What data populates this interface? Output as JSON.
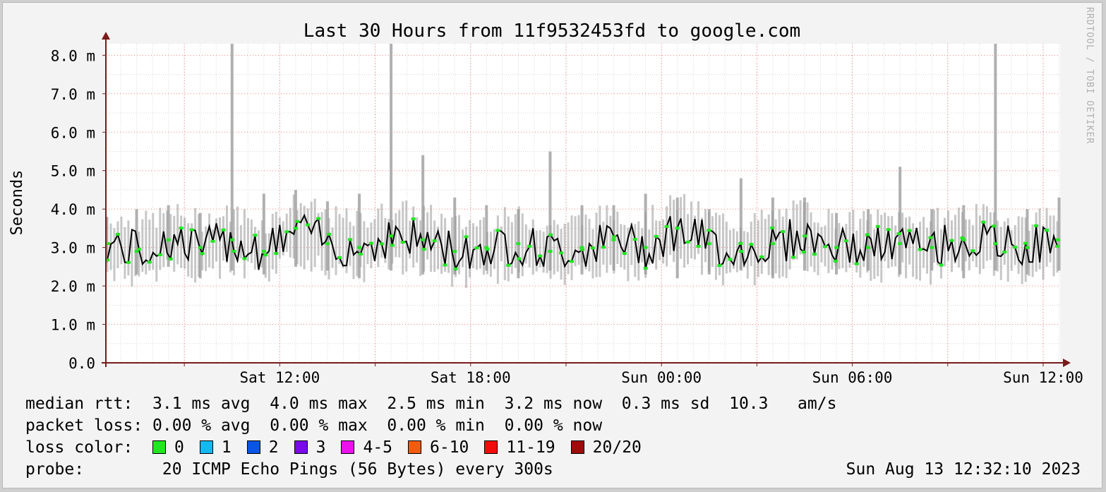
{
  "chart_data": {
    "type": "line",
    "title": "Last 30 Hours from 11f9532453fd to google.com",
    "ylabel": "Seconds",
    "xlabel": "",
    "ylim": [
      0,
      0.0083
    ],
    "y_unit": "s",
    "y_ticks": [
      {
        "value": 0.0,
        "label": "0.0"
      },
      {
        "value": 0.001,
        "label": "1.0 m"
      },
      {
        "value": 0.002,
        "label": "2.0 m"
      },
      {
        "value": 0.003,
        "label": "3.0 m"
      },
      {
        "value": 0.004,
        "label": "4.0 m"
      },
      {
        "value": 0.005,
        "label": "5.0 m"
      },
      {
        "value": 0.006,
        "label": "6.0 m"
      },
      {
        "value": 0.007,
        "label": "7.0 m"
      },
      {
        "value": 0.008,
        "label": "8.0 m"
      }
    ],
    "x_range": [
      "2023-08-12 06:32",
      "2023-08-13 12:32"
    ],
    "x_ticks": [
      {
        "value": "2023-08-12 12:00",
        "label": "Sat 12:00"
      },
      {
        "value": "2023-08-12 18:00",
        "label": "Sat 18:00"
      },
      {
        "value": "2023-08-13 00:00",
        "label": "Sun 00:00"
      },
      {
        "value": "2023-08-13 06:00",
        "label": "Sun 06:00"
      },
      {
        "value": "2023-08-13 12:00",
        "label": "Sun 12:00"
      }
    ],
    "grid": true,
    "series": [
      {
        "name": "median rtt",
        "color": "#000000",
        "marker_color": "#22e622",
        "x": [
          "2023-08-12 06:30",
          "2023-08-12 07:30",
          "2023-08-12 08:30",
          "2023-08-12 09:30",
          "2023-08-12 10:30",
          "2023-08-12 11:30",
          "2023-08-12 12:30",
          "2023-08-12 13:30",
          "2023-08-12 14:30",
          "2023-08-12 15:30",
          "2023-08-12 16:30",
          "2023-08-12 17:30",
          "2023-08-12 18:30",
          "2023-08-12 19:30",
          "2023-08-12 20:30",
          "2023-08-12 21:30",
          "2023-08-12 22:30",
          "2023-08-12 23:30",
          "2023-08-13 00:30",
          "2023-08-13 01:30",
          "2023-08-13 02:30",
          "2023-08-13 03:30",
          "2023-08-13 04:30",
          "2023-08-13 05:30",
          "2023-08-13 06:30",
          "2023-08-13 07:30",
          "2023-08-13 08:30",
          "2023-08-13 09:30",
          "2023-08-13 10:30",
          "2023-08-13 11:30",
          "2023-08-13 12:30"
        ],
        "values": [
          0.0031,
          0.0029,
          0.0032,
          0.003,
          0.0032,
          0.0029,
          0.0035,
          0.0031,
          0.003,
          0.0033,
          0.0032,
          0.0029,
          0.003,
          0.0031,
          0.0029,
          0.003,
          0.0032,
          0.003,
          0.0035,
          0.0031,
          0.0029,
          0.0031,
          0.0033,
          0.003,
          0.003,
          0.0031,
          0.003,
          0.0032,
          0.0031,
          0.003,
          0.0032
        ]
      },
      {
        "name": "max",
        "color": "#b0b0b0",
        "values": [
          0.0038,
          0.004,
          0.0041,
          0.0039,
          0.0083,
          0.0044,
          0.0045,
          0.0042,
          0.0044,
          0.0083,
          0.0054,
          0.0043,
          0.0041,
          0.004,
          0.0055,
          0.0041,
          0.0041,
          0.0044,
          0.0043,
          0.004,
          0.0048,
          0.0043,
          0.0043,
          0.0039,
          0.004,
          0.0051,
          0.004,
          0.0041,
          0.0083,
          0.004,
          0.0043
        ]
      },
      {
        "name": "min",
        "color": "#b0b0b0",
        "values": [
          0.0026,
          0.0023,
          0.0025,
          0.0022,
          0.0024,
          0.0023,
          0.0025,
          0.0024,
          0.0022,
          0.0024,
          0.0023,
          0.0023,
          0.0024,
          0.0022,
          0.0024,
          0.0023,
          0.0024,
          0.0023,
          0.0022,
          0.0023,
          0.0024,
          0.0022,
          0.0024,
          0.0023,
          0.0024,
          0.0023,
          0.0024,
          0.0022,
          0.0024,
          0.0023,
          0.0024
        ]
      }
    ]
  },
  "legend": {
    "median_rtt": {
      "label": "median rtt:",
      "avg": "3.1 ms avg",
      "max": "4.0 ms max",
      "min": "2.5 ms min",
      "now": "3.2 ms now",
      "sd": "0.3 ms sd",
      "ams_value": "10.3",
      "ams_unit": "am/s"
    },
    "packet_loss": {
      "label": "packet loss:",
      "avg": "0.00 % avg",
      "max": "0.00 % max",
      "min": "0.00 % min",
      "now": "0.00 % now"
    },
    "loss_color": {
      "label": "loss color:",
      "items": [
        {
          "label": "0",
          "color": "#22e622"
        },
        {
          "label": "1",
          "color": "#13b9f0"
        },
        {
          "label": "2",
          "color": "#0b55e6"
        },
        {
          "label": "3",
          "color": "#7a0ae8"
        },
        {
          "label": "4-5",
          "color": "#ec10ec"
        },
        {
          "label": "6-10",
          "color": "#f25c0e"
        },
        {
          "label": "11-19",
          "color": "#f20c0c"
        },
        {
          "label": "20/20",
          "color": "#a10a0a"
        }
      ]
    },
    "probe": {
      "label": "probe:",
      "text": "20 ICMP Echo Pings (56 Bytes) every 300s",
      "timestamp": "Sun Aug 13 12:32:10 2023"
    }
  },
  "watermark": "RRDTOOL / TOBI OETIKER",
  "colors": {
    "grid_major": "#f08080",
    "grid_minor": "#d8d8d8",
    "axis": "#7a1a1a",
    "plot_bg": "#ffffff"
  }
}
